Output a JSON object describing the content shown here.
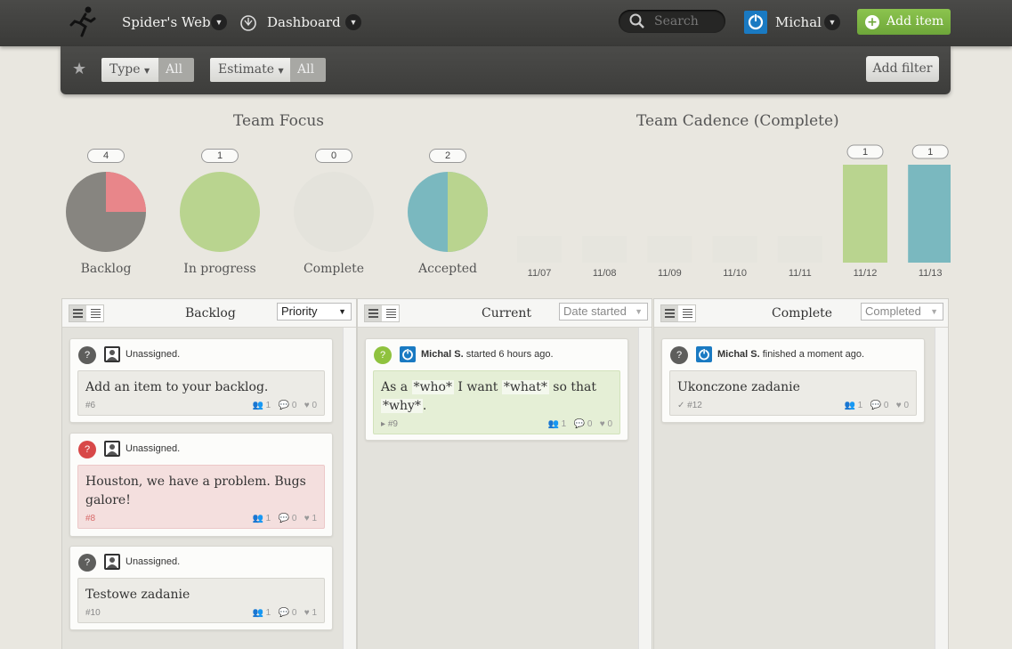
{
  "nav": {
    "project": "Spider's Web",
    "view": "Dashboard",
    "search_placeholder": "Search",
    "user": "Michal",
    "add_item": "Add item"
  },
  "filters": {
    "type_label": "Type",
    "type_value": "All",
    "estimate_label": "Estimate",
    "estimate_value": "All",
    "add_filter": "Add filter"
  },
  "team_focus": {
    "title": "Team Focus",
    "pies": [
      {
        "label": "Backlog",
        "count": "4"
      },
      {
        "label": "In progress",
        "count": "1"
      },
      {
        "label": "Complete",
        "count": "0"
      },
      {
        "label": "Accepted",
        "count": "2"
      }
    ]
  },
  "chart_data": {
    "type": "bar",
    "title": "Team Cadence (Complete)",
    "categories": [
      "11/07",
      "11/08",
      "11/09",
      "11/10",
      "11/11",
      "11/12",
      "11/13"
    ],
    "values": [
      0,
      0,
      0,
      0,
      0,
      1,
      1
    ],
    "data_labels": [
      "",
      "",
      "",
      "",
      "",
      "1",
      "1"
    ],
    "colors": [
      "#e4e3dc",
      "#e4e3dc",
      "#e4e3dc",
      "#e4e3dc",
      "#e4e3dc",
      "#b9d48f",
      "#7ab8bf"
    ]
  },
  "columns": [
    {
      "title": "Backlog",
      "sort": "Priority",
      "cards": [
        {
          "user": "Unassigned.",
          "text": "Add an item to your backlog.",
          "num": "#6",
          "assignees": "1",
          "comments": "0",
          "likes": "0"
        },
        {
          "user": "Unassigned.",
          "text": "Houston, we have a problem. Bugs galore!",
          "num": "#8",
          "assignees": "1",
          "comments": "0",
          "likes": "1"
        },
        {
          "user": "Unassigned.",
          "text": "Testowe zadanie",
          "num": "#10",
          "assignees": "1",
          "comments": "0",
          "likes": "1"
        }
      ]
    },
    {
      "title": "Current",
      "sort": "Date started",
      "cards": [
        {
          "user_name": "Michal S.",
          "user_action": "started 6 hours ago.",
          "text_parts": [
            "As a ",
            "*who*",
            " I want ",
            "*what*",
            " so that ",
            "*why*",
            "."
          ],
          "num": "#9",
          "assignees": "1",
          "comments": "0",
          "likes": "0"
        }
      ]
    },
    {
      "title": "Complete",
      "sort": "Completed",
      "cards": [
        {
          "user_name": "Michal S.",
          "user_action": "finished a moment ago.",
          "text": "Ukonczone zadanie",
          "num": "#12",
          "assignees": "1",
          "comments": "0",
          "likes": "0"
        }
      ]
    }
  ],
  "colors": {
    "green": "#b9d48f",
    "teal": "#7ab8bf",
    "red": "#e8868a",
    "grey": "#878580",
    "accent": "#7cb844"
  }
}
